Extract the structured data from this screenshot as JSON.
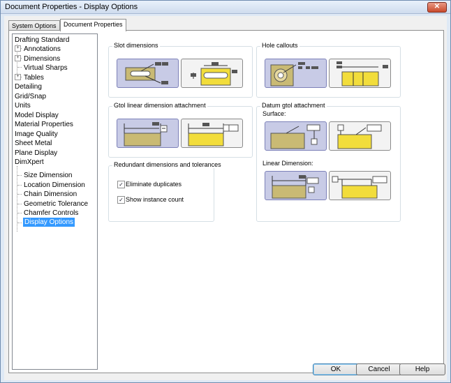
{
  "window": {
    "title": "Document Properties - Display Options",
    "close_glyph": "✕"
  },
  "tabs": [
    {
      "label": "System Options"
    },
    {
      "label": "Document Properties"
    }
  ],
  "tree": {
    "items": [
      {
        "label": "Drafting Standard"
      },
      {
        "label": "Annotations"
      },
      {
        "label": "Dimensions"
      },
      {
        "label": "Virtual Sharps"
      },
      {
        "label": "Tables"
      },
      {
        "label": "Detailing"
      },
      {
        "label": "Grid/Snap"
      },
      {
        "label": "Units"
      },
      {
        "label": "Model Display"
      },
      {
        "label": "Material Properties"
      },
      {
        "label": "Image Quality"
      },
      {
        "label": "Sheet Metal"
      },
      {
        "label": "Plane Display"
      },
      {
        "label": "DimXpert"
      },
      {
        "label": "Size Dimension"
      },
      {
        "label": "Location Dimension"
      },
      {
        "label": "Chain Dimension"
      },
      {
        "label": "Geometric Tolerance"
      },
      {
        "label": "Chamfer Controls"
      },
      {
        "label": "Display Options"
      }
    ],
    "expand_glyph": "+"
  },
  "groups": {
    "slot": {
      "title": "Slot dimensions"
    },
    "hole": {
      "title": "Hole callouts"
    },
    "gtol": {
      "title": "Gtol linear dimension attachment"
    },
    "datum": {
      "title": "Datum gtol attachment",
      "surface_label": "Surface:",
      "linear_label": "Linear Dimension:"
    },
    "redundant": {
      "title": "Redundant dimensions and tolerances",
      "eliminate_label": "Eliminate duplicates",
      "eliminate_checked": true,
      "show_count_label": "Show instance count",
      "show_count_checked": true
    }
  },
  "check_glyph": "✓",
  "buttons": {
    "ok": "OK",
    "cancel": "Cancel",
    "help": "Help"
  }
}
